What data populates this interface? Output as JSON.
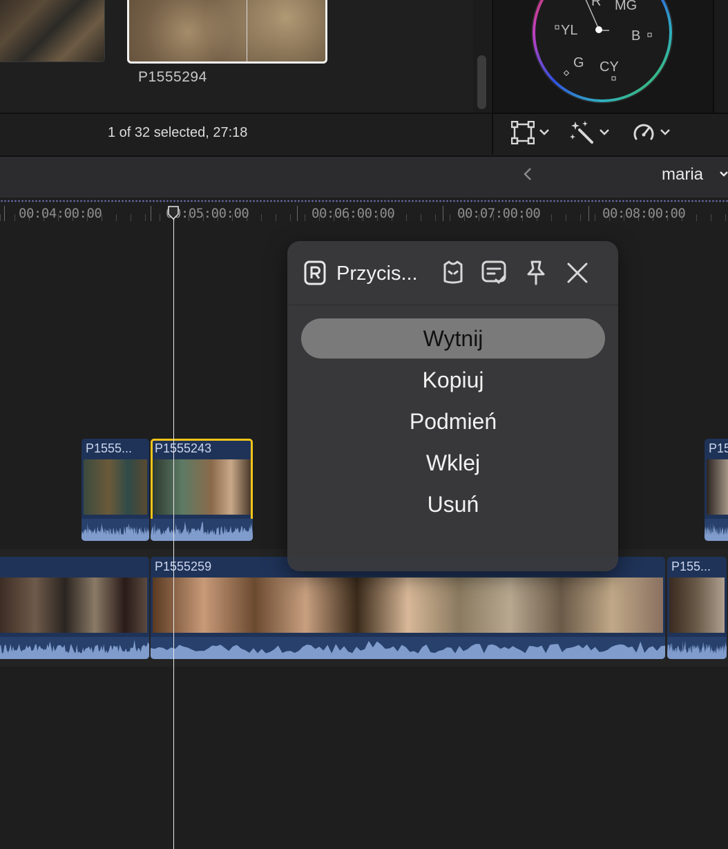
{
  "browser": {
    "selected_clip_name": "P1555294",
    "status_text": "1 of 32 selected, 27:18"
  },
  "scope": {
    "labels": [
      "R",
      "MG",
      "YL",
      "B",
      "G",
      "CY"
    ]
  },
  "toolbar": {
    "icons": [
      "crop-icon",
      "magic-wand-icon",
      "speed-icon"
    ]
  },
  "header": {
    "back_icon": "chevron-left",
    "project_name": "maria",
    "project_chevron": "chevron-down"
  },
  "ruler": {
    "timecodes": [
      "00:04:00:00",
      "00:05:00:00",
      "00:06:00:00",
      "00:07:00:00",
      "00:08:00:00"
    ]
  },
  "clips": {
    "connected": [
      "P1555...",
      "P1555243",
      "P15"
    ],
    "storyline": [
      "P1555259",
      "P155..."
    ]
  },
  "popup": {
    "title": "Przycis...",
    "header_icons": [
      "r-logo-icon",
      "shirt-icon",
      "notes-check-icon",
      "pin-icon",
      "close-icon"
    ],
    "menu": [
      "Wytnij",
      "Kopiuj",
      "Podmień",
      "Wklej",
      "Usuń"
    ]
  },
  "colors": {
    "selection": "#f5c518",
    "clip": "#1f3358",
    "audio": "#27406c",
    "menu_highlight": "#7a7a7a"
  }
}
